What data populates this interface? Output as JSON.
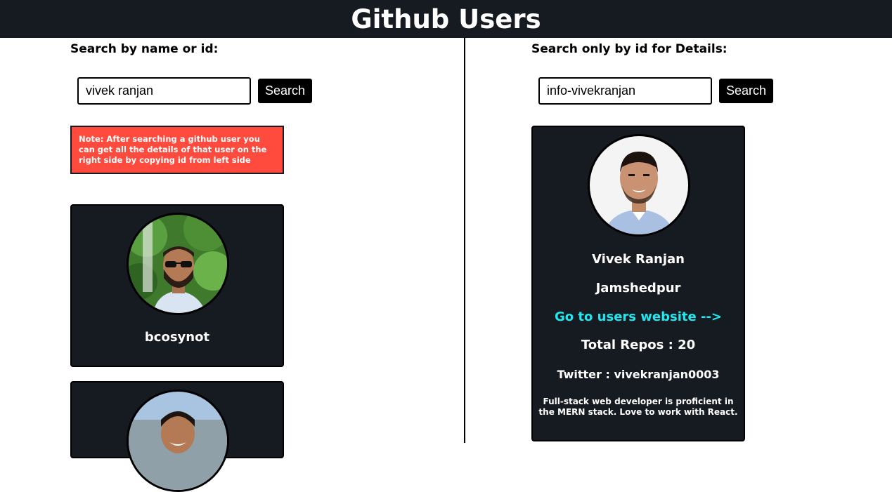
{
  "app": {
    "title": "Github Users"
  },
  "left_panel": {
    "label": "Search by name or id:",
    "search_value": "vivek ranjan",
    "search_button": "Search",
    "note": "Note: After searching a github user you can get all the details of that user on the right side by copying id from left side",
    "results": [
      {
        "username": "bcosynot"
      },
      {
        "username": ""
      }
    ]
  },
  "right_panel": {
    "label": "Search only by id for Details:",
    "search_value": "info-vivekranjan",
    "search_button": "Search",
    "details": {
      "name": "Vivek Ranjan",
      "location": "Jamshedpur",
      "website_link": "Go to users website -->",
      "total_repos": "Total Repos : 20",
      "twitter": "Twitter : vivekranjan0003",
      "bio": "Full-stack web developer is proficient in the MERN stack. Love to work with React."
    }
  },
  "colors": {
    "header_bg": "#161a21",
    "card_bg": "#161a21",
    "note_bg": "#ff4b3e",
    "link": "#1ee9f0"
  }
}
